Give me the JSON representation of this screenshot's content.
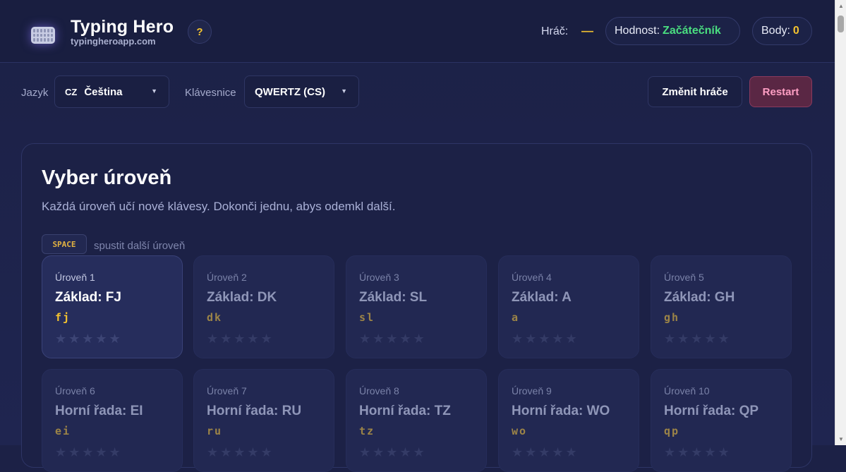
{
  "header": {
    "logo_icon": "keyboard-icon",
    "title": "Typing Hero",
    "subtitle": "typingheroapp.com",
    "help_label": "?",
    "player_label": "Hráč:",
    "player_value": "—",
    "rank_label": "Hodnost:",
    "rank_value": "Začátečník",
    "score_label": "Body:",
    "score_value": "0"
  },
  "controls": {
    "language_label": "Jazyk",
    "language_flag": "CZ",
    "language_value": "Čeština",
    "keyboard_label": "Klávesnice",
    "keyboard_value": "QWERTZ (CS)",
    "caret": "▼",
    "change_player_label": "Změnit hráče",
    "restart_label": "Restart"
  },
  "main": {
    "title": "Vyber úroveň",
    "subtitle": "Každá úroveň učí nové klávesy. Dokonči jednu, abys odemkl další.",
    "space_key": "SPACE",
    "space_hint": "spustit další úroveň",
    "stars": "★★★★★",
    "levels": [
      {
        "level": "Úroveň 1",
        "name": "Základ: FJ",
        "keys": "fj",
        "active": true
      },
      {
        "level": "Úroveň 2",
        "name": "Základ: DK",
        "keys": "dk",
        "active": false
      },
      {
        "level": "Úroveň 3",
        "name": "Základ: SL",
        "keys": "sl",
        "active": false
      },
      {
        "level": "Úroveň 4",
        "name": "Základ: A",
        "keys": "a",
        "active": false
      },
      {
        "level": "Úroveň 5",
        "name": "Základ: GH",
        "keys": "gh",
        "active": false
      },
      {
        "level": "Úroveň 6",
        "name": "Horní řada: EI",
        "keys": "ei",
        "active": false
      },
      {
        "level": "Úroveň 7",
        "name": "Horní řada: RU",
        "keys": "ru",
        "active": false
      },
      {
        "level": "Úroveň 8",
        "name": "Horní řada: TZ",
        "keys": "tz",
        "active": false
      },
      {
        "level": "Úroveň 9",
        "name": "Horní řada: WO",
        "keys": "wo",
        "active": false
      },
      {
        "level": "Úroveň 10",
        "name": "Horní řada: QP",
        "keys": "qp",
        "active": false
      }
    ]
  },
  "colors": {
    "accent_yellow": "#f4c32f",
    "rank_green": "#4ade80",
    "restart_pink": "#ff9fc4"
  }
}
